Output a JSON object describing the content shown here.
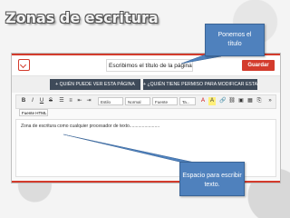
{
  "slide": {
    "title": "Zonas de escritura"
  },
  "editor": {
    "title_value": "Escribimos el título de la página",
    "save_label": "Guardar",
    "permissions": {
      "view_label": "+ QUIÉN PUEDE VER ESTA PÁGINA",
      "edit_label": "+ ¿QUIÉN TIENE PERMISO PARA MODIFICAR ESTA PÁGINA?"
    },
    "toolbar": {
      "bold": "B",
      "italic": "I",
      "underline": "U",
      "strike": "S",
      "style_select": "Estilo",
      "format_select": "Normal",
      "font_select": "Fuente",
      "size_select": "Ta..."
    },
    "source_label": "Fuente HTML",
    "content_text": "Zona de escritura como cualquier procesador de texto........................"
  },
  "callouts": {
    "top": [
      "Ponemos el",
      "título"
    ],
    "bottom": [
      "Espacio para escribir",
      "texto."
    ]
  },
  "colors": {
    "accent_red": "#d33b2c",
    "permission_bar": "#3e4a59",
    "callout_blue": "#4f81bd"
  }
}
